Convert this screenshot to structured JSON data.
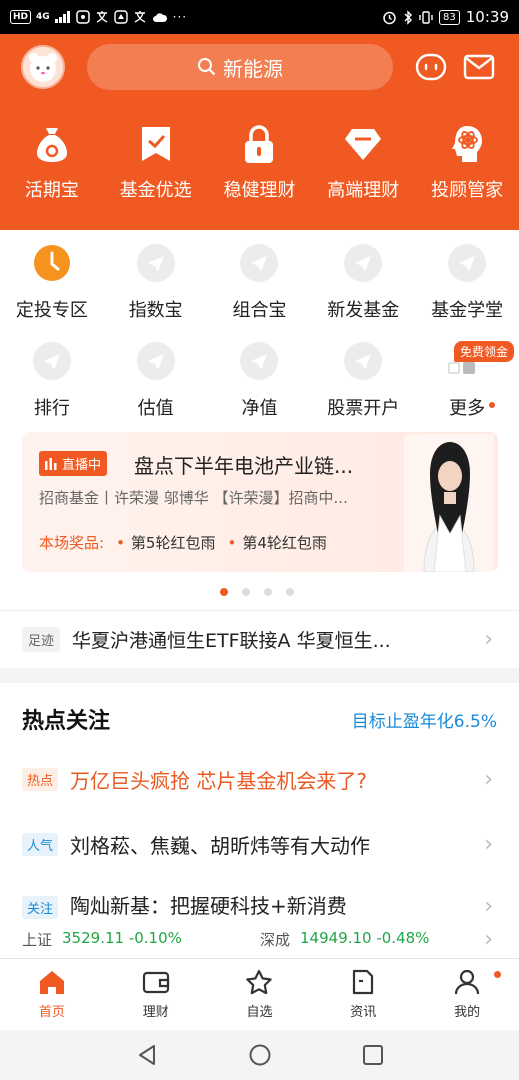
{
  "status_bar": {
    "network": "HD",
    "signal": "4G",
    "battery": "83",
    "time": "10:39"
  },
  "header": {
    "search_text": "新能源",
    "quick_links": [
      {
        "label": "活期宝",
        "icon": "money-bag-icon"
      },
      {
        "label": "基金优选",
        "icon": "bookmark-check-icon"
      },
      {
        "label": "稳健理财",
        "icon": "lock-icon"
      },
      {
        "label": "高端理财",
        "icon": "diamond-icon"
      },
      {
        "label": "投顾管家",
        "icon": "advisor-icon"
      }
    ]
  },
  "menu": {
    "row1": [
      {
        "label": "定投专区",
        "icon": "clock-icon"
      },
      {
        "label": "指数宝",
        "icon": "placeholder-icon"
      },
      {
        "label": "组合宝",
        "icon": "placeholder-icon"
      },
      {
        "label": "新发基金",
        "icon": "placeholder-icon"
      },
      {
        "label": "基金学堂",
        "icon": "placeholder-icon"
      }
    ],
    "row2": [
      {
        "label": "排行",
        "icon": "placeholder-icon"
      },
      {
        "label": "估值",
        "icon": "placeholder-icon"
      },
      {
        "label": "净值",
        "icon": "placeholder-icon"
      },
      {
        "label": "股票开户",
        "icon": "placeholder-icon"
      },
      {
        "label": "更多",
        "icon": "more-grid-icon"
      }
    ],
    "free_badge": "免费领金"
  },
  "live_card": {
    "tag": "直播中",
    "title": "盘点下半年电池产业链...",
    "subtitle": "招商基金丨许荣漫 邬博华 【许荣漫】招商中...",
    "prize_label": "本场奖品:",
    "prizes": [
      "第5轮红包雨",
      "第4轮红包雨"
    ]
  },
  "footprint": {
    "tag": "足迹",
    "text": "华夏沪港通恒生ETF联接A  华夏恒生..."
  },
  "hot": {
    "title": "热点关注",
    "link": "目标止盈年化6.5%",
    "items": [
      {
        "tag": "热点",
        "text": "万亿巨头疯抢 芯片基金机会来了?"
      },
      {
        "tag": "人气",
        "text": "刘格菘、焦巍、胡昕炜等有大动作"
      },
      {
        "tag": "关注",
        "text": "陶灿新基：把握硬科技+新消费"
      }
    ]
  },
  "ticker": {
    "items": [
      {
        "name": "上证",
        "value": "3529.11 -0.10%"
      },
      {
        "name": "深成",
        "value": "14949.10 -0.48%"
      }
    ]
  },
  "bottom_nav": {
    "items": [
      {
        "label": "首页",
        "icon": "home-icon"
      },
      {
        "label": "理财",
        "icon": "wallet-icon"
      },
      {
        "label": "自选",
        "icon": "star-icon"
      },
      {
        "label": "资讯",
        "icon": "document-icon"
      },
      {
        "label": "我的",
        "icon": "user-icon"
      }
    ]
  },
  "colors": {
    "brand": "#f05a22",
    "link": "#1a8ad8",
    "down": "#22a647"
  }
}
